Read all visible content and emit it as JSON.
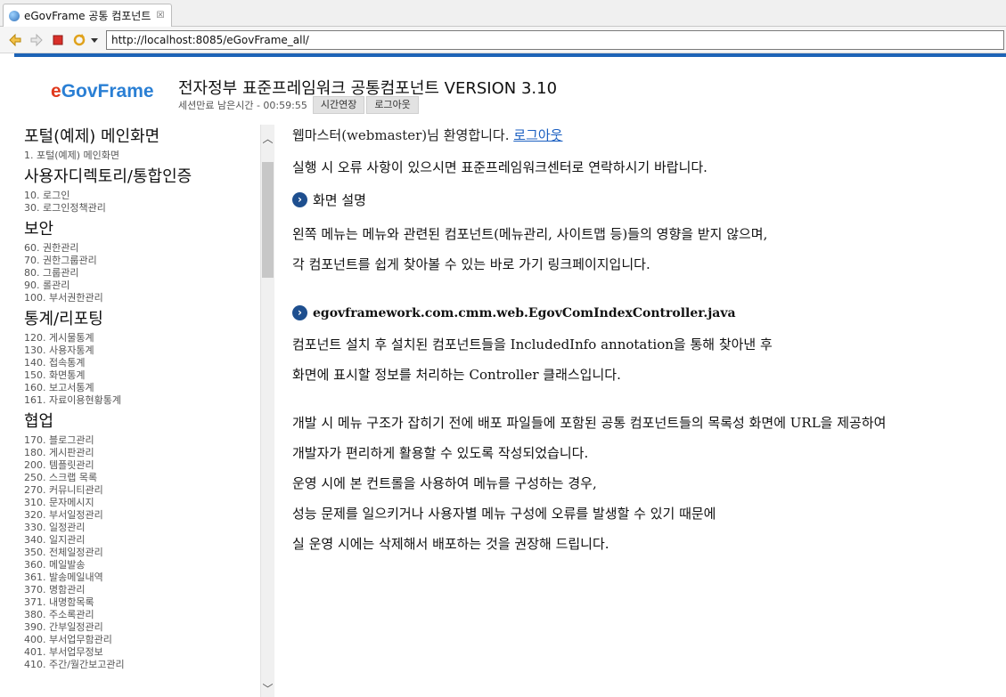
{
  "browser": {
    "tab_title": "eGovFrame 공통 컴포넌트",
    "tab_close": "☒",
    "url": "http://localhost:8085/eGovFrame_all/"
  },
  "header": {
    "logo_e": "e",
    "logo_rest": "GovFrame",
    "title": "전자정부 표준프레임워크 공통컴포넌트 VERSION 3.10",
    "session_label": "세션만료 남은시간 - 00:59:55",
    "extend_button": "시간연장",
    "logout_button": "로그아웃"
  },
  "menu": [
    {
      "title": "포털(예제) 메인화면",
      "items": [
        "1. 포털(예제) 메인화면"
      ]
    },
    {
      "title": "사용자디렉토리/통합인증",
      "items": [
        "10. 로그인",
        "30. 로그인정책관리"
      ]
    },
    {
      "title": "보안",
      "items": [
        "60. 권한관리",
        "70. 권한그룹관리",
        "80. 그룹관리",
        "90. 롤관리",
        "100. 부서권한관리"
      ]
    },
    {
      "title": "통계/리포팅",
      "items": [
        "120. 게시물통계",
        "130. 사용자통계",
        "140. 접속통계",
        "150. 화면통계",
        "160. 보고서통계",
        "161. 자료이용현황통계"
      ]
    },
    {
      "title": "협업",
      "items": [
        "170. 블로그관리",
        "180. 게시판관리",
        "200. 템플릿관리",
        "250. 스크랩 목록",
        "270. 커뮤니티관리",
        "310. 문자메시지",
        "320. 부서일정관리",
        "330. 일정관리",
        "340. 일지관리",
        "350. 전체일정관리",
        "360. 메일발송",
        "361. 발송메일내역",
        "370. 명함관리",
        "371. 내명함목록",
        "380. 주소록관리",
        "390. 간부일정관리",
        "400. 부서업무함관리",
        "401. 부서업무정보",
        "410. 주간/월간보고관리"
      ]
    }
  ],
  "content": {
    "welcome_text": "웹마스터(webmaster)님 환영합니다. ",
    "welcome_link": "로그아웃",
    "error_notice": "실행 시 오류 사항이 있으시면 표준프레임워크센터로 연락하시기 바랍니다.",
    "section1_title": "화면 설명",
    "section1_line1": "왼쪽 메뉴는 메뉴와 관련된 컴포넌트(메뉴관리, 사이트맵 등)들의 영향을 받지 않으며,",
    "section1_line2": "각 컴포넌트를 쉽게 찾아볼 수 있는 바로 가기 링크페이지입니다.",
    "section2_title": "egovframework.com.cmm.web.EgovComIndexController.java",
    "section2_line1": "컴포넌트 설치 후 설치된 컴포넌트들을 IncludedInfo annotation을 통해 찾아낸 후",
    "section2_line2": "화면에 표시할 정보를 처리하는 Controller 클래스입니다.",
    "para_line1": "개발 시 메뉴 구조가 잡히기 전에 배포 파일들에 포함된 공통 컴포넌트들의 목록성 화면에 URL을 제공하여",
    "para_line2": "개발자가 편리하게 활용할 수 있도록 작성되었습니다.",
    "para_line3": "운영 시에 본 컨트롤을 사용하여 메뉴를 구성하는 경우,",
    "para_line4": "성능 문제를 일으키거나 사용자별 메뉴 구성에 오류를 발생할 수 있기 때문에",
    "para_line5": "실 운영 시에는 삭제해서 배포하는 것을 권장해 드립니다."
  },
  "colors": {
    "accent_bar": "#1d63b6",
    "logo_red": "#e03a1e",
    "logo_blue": "#2a7fd4",
    "link": "#1b5fc1",
    "chevron": "#1e4f8f"
  },
  "icons": {
    "back": "back-arrow-icon",
    "forward": "forward-arrow-icon",
    "stop": "stop-icon",
    "refresh": "refresh-icon",
    "dropdown": "chevron-down-icon",
    "section_marker": "chevron-right-icon"
  }
}
